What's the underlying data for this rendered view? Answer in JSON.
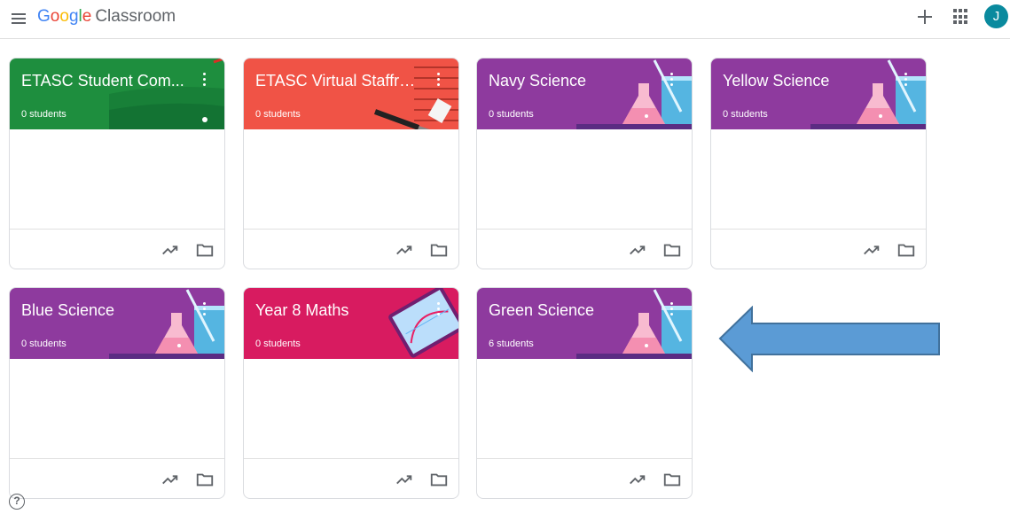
{
  "header": {
    "logo_parts": [
      "G",
      "o",
      "o",
      "g",
      "l",
      "e"
    ],
    "product": "Classroom",
    "avatar_letter": "J"
  },
  "classes": [
    {
      "title": "ETASC Student Com...",
      "students": "0 students",
      "color": "#1e8e3e",
      "art": "field"
    },
    {
      "title": "ETASC Virtual Staffro...",
      "students": "0 students",
      "color": "#f05346",
      "art": "grill"
    },
    {
      "title": "Navy Science",
      "students": "0 students",
      "color": "#8e3a9e",
      "art": "lab"
    },
    {
      "title": "Yellow Science",
      "students": "0 students",
      "color": "#8e3a9e",
      "art": "lab"
    },
    {
      "title": "Blue Science",
      "students": "0 students",
      "color": "#8e3a9e",
      "art": "lab"
    },
    {
      "title": "Year 8 Maths",
      "students": "0 students",
      "color": "#d81b60",
      "art": "tablet"
    },
    {
      "title": "Green Science",
      "students": "6 students",
      "color": "#8e3a9e",
      "art": "lab"
    }
  ],
  "icons": {
    "menu": "menu-icon",
    "create": "plus-icon",
    "apps": "apps-grid-icon",
    "more": "more-vert-icon",
    "gradebook": "trending-up-icon",
    "folder": "folder-icon",
    "help": "help-icon",
    "help_glyph": "?"
  },
  "annotation": {
    "color": "#5b9bd5"
  }
}
